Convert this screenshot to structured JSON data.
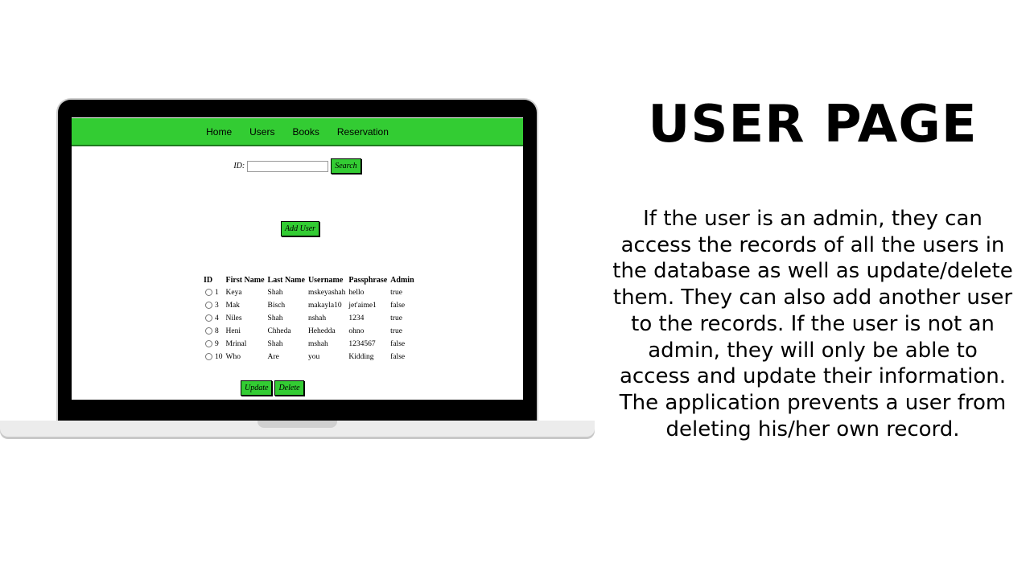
{
  "nav": {
    "items": [
      "Home",
      "Users",
      "Books",
      "Reservation"
    ]
  },
  "search": {
    "id_label": "ID:",
    "id_value": "",
    "button_label": "Search"
  },
  "add_user_label": "Add User",
  "table": {
    "headers": [
      "ID",
      "First Name",
      "Last Name",
      "Username",
      "Passphrase",
      "Admin"
    ],
    "rows": [
      [
        "1",
        "Keya",
        "Shah",
        "mskeyashah",
        "hello",
        "true"
      ],
      [
        "3",
        "Mak",
        "Bisch",
        "makayla10",
        "jet'aime1",
        "false"
      ],
      [
        "4",
        "Niles",
        "Shah",
        "nshah",
        "1234",
        "true"
      ],
      [
        "8",
        "Heni",
        "Chheda",
        "Hehedda",
        "ohno",
        "true"
      ],
      [
        "9",
        "Mrinal",
        "Shah",
        "mshah",
        "1234567",
        "false"
      ],
      [
        "10",
        "Who",
        "Are",
        "you",
        "Kidding",
        "false"
      ]
    ]
  },
  "actions": {
    "update_label": "Update",
    "delete_label": "Delete"
  },
  "slide": {
    "title": "USER PAGE",
    "description": "If the user is an admin, they can access the records of all the users in the database as well as update/delete them. They can also add another user to the records. If the user is not an admin, they will only be able to access and update their information. The application prevents a user from deleting his/her own record."
  },
  "colors": {
    "nav_green": "#33cc33",
    "button_green": "#33cc33",
    "bezel": "#000000"
  }
}
